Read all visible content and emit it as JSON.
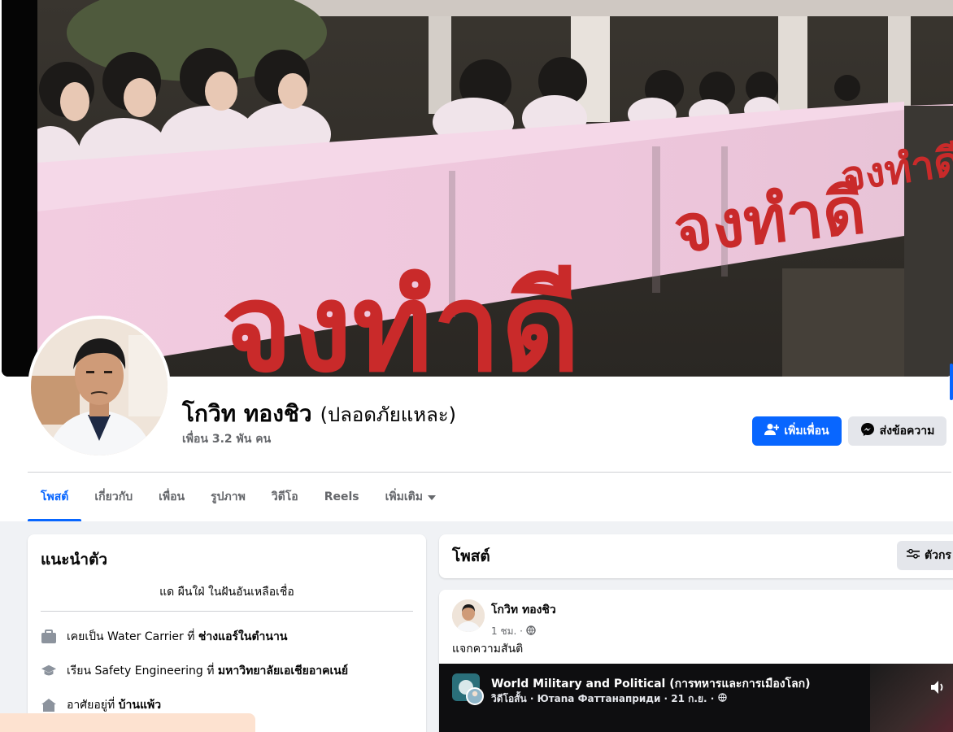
{
  "profile": {
    "name": "โกวิท ทองชิว",
    "nickname": "(ปลอดภัยแหละ)",
    "friends": "เพื่อน 3.2 พัน คน",
    "add_friend": "เพิ่มเพื่อน",
    "message": "ส่งข้อความ",
    "cover_text": "จงทำดี"
  },
  "tabs": [
    {
      "label": "โพสต์"
    },
    {
      "label": "เกี่ยวกับ"
    },
    {
      "label": "เพื่อน"
    },
    {
      "label": "รูปภาพ"
    },
    {
      "label": "วิดีโอ"
    },
    {
      "label": "Reels"
    },
    {
      "label": "เพิ่มเติม"
    }
  ],
  "intro": {
    "title": "แนะนำตัว",
    "bio": "แด ผืนใฝ่ ในฝันอันเหลือเชื่อ",
    "work_prefix": "เคยเป็น Water Carrier ที่",
    "work_place": "ช่างแอร์ในตำนาน",
    "edu_prefix": "เรียน Safety Engineering ที่",
    "edu_place": "มหาวิทยาลัยเอเชียอาคเนย์",
    "home_prefix": "อาศัยอยู่ที่",
    "home_place": "บ้านแพ้ว"
  },
  "posts": {
    "title": "โพสต์",
    "filter": "ตัวกร",
    "post": {
      "author": "โกวิท ทองชิว",
      "time": "1 ชม. ·",
      "text": "แจกความสันติ",
      "video_title": "World Military and Political (การทหารและการเมืองโลก)",
      "video_sub": "วิดีโอสั้น · Ютana Фаттанаприди · 21 ก.ย. ·"
    }
  },
  "colors": {
    "accent": "#0866ff",
    "secondary_button": "#e4e6eb",
    "background": "#f0f2f5"
  }
}
